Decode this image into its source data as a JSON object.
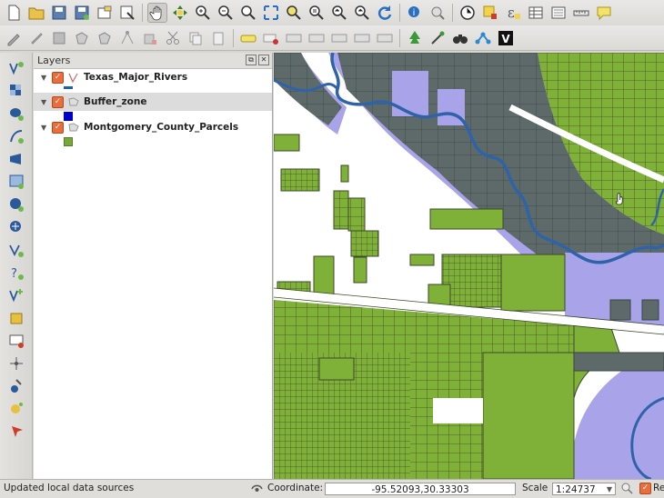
{
  "layers_panel": {
    "title": "Layers",
    "layers": [
      {
        "name": "Texas_Major_Rivers",
        "checked": true,
        "legend_color": "#2060a8"
      },
      {
        "name": "Buffer_zone",
        "checked": true,
        "legend_color": "#0000cc"
      },
      {
        "name": "Montgomery_County_Parcels",
        "checked": true,
        "legend_color": "#76a83a"
      }
    ]
  },
  "statusbar": {
    "message": "Updated local data sources",
    "coordinate_label": "Coordinate:",
    "coordinate_value": "-95.52093,30.33303",
    "scale_label": "Scale",
    "scale_value": "1:24737",
    "render_label": "Re"
  },
  "map": {
    "colors": {
      "buffer": "#a9a3ea",
      "parcels": "#7fb038",
      "overlap": "#5e6a6a",
      "river": "#2f63a8",
      "road": "#ffffff"
    }
  }
}
